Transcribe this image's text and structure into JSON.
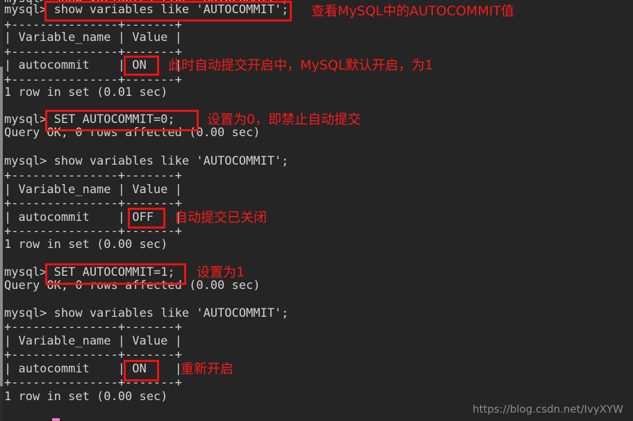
{
  "terminal": {
    "background_color": "#252525",
    "text_color": "#d4d4d4",
    "annotation_color": "#f91b1b",
    "cursor_color": "#f07ac0",
    "prompt": "mysql>",
    "lines": [
      {
        "id": "l00",
        "text": "mysql> show variables like 'AUTOCOMMIT';"
      },
      {
        "id": "l01",
        "text": "+---------------+-------+"
      },
      {
        "id": "l02",
        "text": "| Variable_name | Value |"
      },
      {
        "id": "l03",
        "text": "+---------------+-------+"
      },
      {
        "id": "l04",
        "text": "| autocommit    | ON    |"
      },
      {
        "id": "l05",
        "text": "+---------------+-------+"
      },
      {
        "id": "l06",
        "text": "1 row in set (0.01 sec)"
      },
      {
        "id": "l07",
        "text": ""
      },
      {
        "id": "l08",
        "text": "mysql> SET AUTOCOMMIT=0;"
      },
      {
        "id": "l09",
        "text": "Query OK, 0 rows affected (0.00 sec)"
      },
      {
        "id": "l10",
        "text": ""
      },
      {
        "id": "l11",
        "text": "mysql> show variables like 'AUTOCOMMIT';"
      },
      {
        "id": "l12",
        "text": "+---------------+-------+"
      },
      {
        "id": "l13",
        "text": "| Variable_name | Value |"
      },
      {
        "id": "l14",
        "text": "+---------------+-------+"
      },
      {
        "id": "l15",
        "text": "| autocommit    | OFF   |"
      },
      {
        "id": "l16",
        "text": "+---------------+-------+"
      },
      {
        "id": "l17",
        "text": "1 row in set (0.00 sec)"
      },
      {
        "id": "l18",
        "text": ""
      },
      {
        "id": "l19",
        "text": "mysql> SET AUTOCOMMIT=1;"
      },
      {
        "id": "l20",
        "text": "Query OK, 0 rows affected (0.00 sec)"
      },
      {
        "id": "l21",
        "text": ""
      },
      {
        "id": "l22",
        "text": "mysql> show variables like 'AUTOCOMMIT';"
      },
      {
        "id": "l23",
        "text": "+---------------+-------+"
      },
      {
        "id": "l24",
        "text": "| Variable_name | Value |"
      },
      {
        "id": "l25",
        "text": "+---------------+-------+"
      },
      {
        "id": "l26",
        "text": "| autocommit    | ON    |"
      },
      {
        "id": "l27",
        "text": "+---------------+-------+"
      },
      {
        "id": "l28",
        "text": "1 row in set (0.00 sec)"
      }
    ],
    "commands": [
      "show variables like 'AUTOCOMMIT';",
      "SET AUTOCOMMIT=0;",
      "show variables like 'AUTOCOMMIT';",
      "SET AUTOCOMMIT=1;",
      "show variables like 'AUTOCOMMIT';"
    ],
    "variable_results": [
      {
        "Variable_name": "autocommit",
        "Value": "ON"
      },
      {
        "Variable_name": "autocommit",
        "Value": "OFF"
      },
      {
        "Variable_name": "autocommit",
        "Value": "ON"
      }
    ],
    "row_counts": [
      "1 row in set (0.01 sec)",
      "1 row in set (0.00 sec)",
      "1 row in set (0.00 sec)"
    ],
    "query_ok": "Query OK, 0 rows affected (0.00 sec)"
  },
  "annotations": [
    {
      "id": "a1",
      "text": "查看MySQL中的AUTOCOMMIT值"
    },
    {
      "id": "a2",
      "text": "此时自动提交开启中，MySQL默认开启，为1"
    },
    {
      "id": "a3",
      "text": "设置为0，即禁止自动提交"
    },
    {
      "id": "a4",
      "text": "自动提交已关闭"
    },
    {
      "id": "a5",
      "text": "设置为1"
    },
    {
      "id": "a6",
      "text": "重新开启"
    }
  ],
  "watermark": {
    "text": "https://blog.csdn.net/IvyXYW"
  }
}
